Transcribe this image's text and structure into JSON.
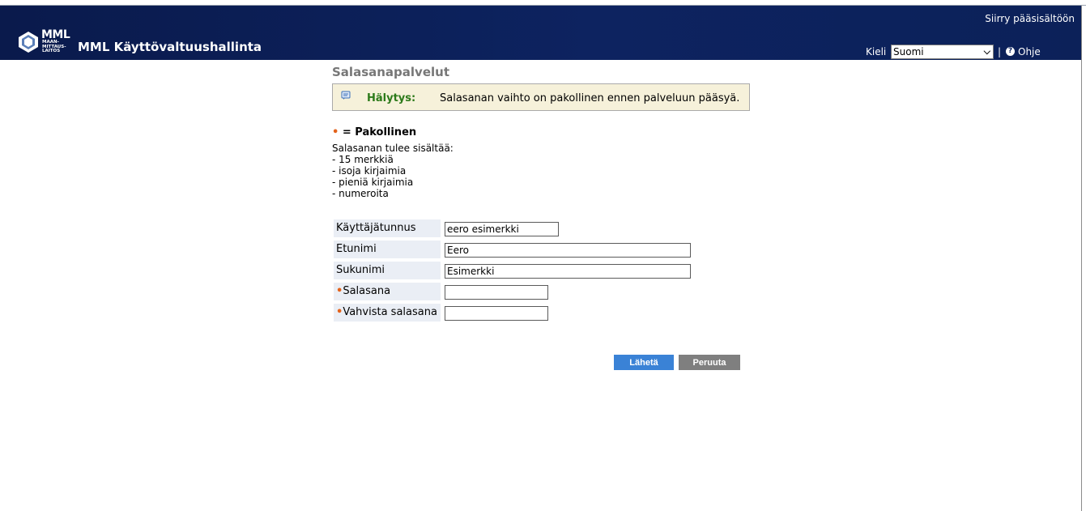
{
  "header": {
    "skip_link": "Siirry pääsisältöön",
    "logo_brand": "MML",
    "logo_sub": [
      "MAAN-",
      "MITTAUS-",
      "LAITOS"
    ],
    "app_title": "MML Käyttövaltuushallinta",
    "language_label": "Kieli",
    "language_selected": "Suomi",
    "separator": "|",
    "help_label": "Ohje"
  },
  "page": {
    "title": "Salasanapalvelut",
    "alert": {
      "label": "Hälytys:",
      "message": "Salasanan vaihto on pakollinen ennen palveluun pääsyä."
    },
    "required_legend": "= Pakollinen",
    "rules_title": "Salasanan tulee sisältää:",
    "rules": [
      "- 15 merkkiä",
      "- isoja kirjaimia",
      "- pieniä kirjaimia",
      "- numeroita"
    ]
  },
  "form": {
    "fields": [
      {
        "label": "Käyttäjätunnus",
        "value": "eero esimerkki",
        "required": false
      },
      {
        "label": "Etunimi",
        "value": "Eero",
        "required": false
      },
      {
        "label": "Sukunimi",
        "value": "Esimerkki",
        "required": false
      },
      {
        "label": "Salasana",
        "value": "",
        "required": true
      },
      {
        "label": "Vahvista salasana",
        "value": "",
        "required": true
      }
    ],
    "submit_label": "Lähetä",
    "cancel_label": "Peruuta"
  },
  "colors": {
    "header_bg": "#0d2360",
    "required_dot": "#e3631c",
    "alert_label": "#2c7a1a",
    "submit_bg": "#3a82d6",
    "cancel_bg": "#7f7f7f"
  }
}
